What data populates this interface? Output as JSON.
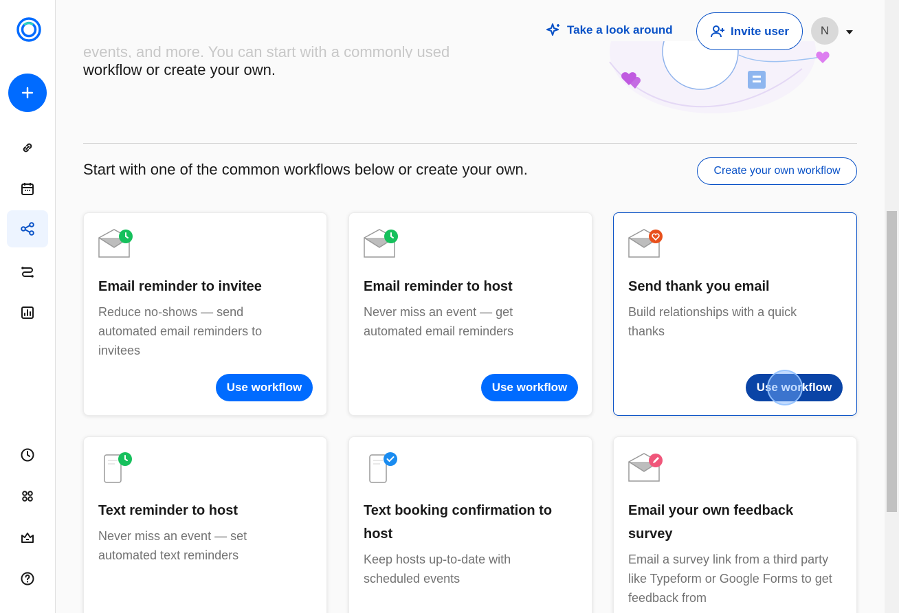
{
  "brand": {
    "accent": "#006bff",
    "accent_dark": "#0a52c7",
    "logo_icon": "calendly-logo"
  },
  "sidebar": {
    "create_icon": "plus-icon",
    "items": [
      {
        "name": "scheduling",
        "icon": "link-icon"
      },
      {
        "name": "meetings",
        "icon": "calendar-icon"
      },
      {
        "name": "workflows",
        "icon": "workflow-icon",
        "active": true
      },
      {
        "name": "routing",
        "icon": "routing-icon"
      },
      {
        "name": "analytics",
        "icon": "analytics-icon"
      }
    ],
    "bottom_items": [
      {
        "name": "availability",
        "icon": "clock-icon"
      },
      {
        "name": "integrations",
        "icon": "apps-icon"
      },
      {
        "name": "admin",
        "icon": "crown-icon"
      },
      {
        "name": "help",
        "icon": "help-icon"
      }
    ]
  },
  "header": {
    "tour_label": "Take a look around",
    "invite_label": "Invite user",
    "avatar_initial": "N"
  },
  "intro": {
    "faded_line": "events, and more. You can start with a commonly used",
    "line": "workflow or create your own."
  },
  "section": {
    "heading": "Start with one of the common workflows below or create your own.",
    "create_label": "Create your own workflow"
  },
  "cards": [
    {
      "title": "Email reminder to invitee",
      "desc": "Reduce no-shows — send automated email reminders to invitees",
      "button": "Use workflow",
      "icon": "email-clock-icon"
    },
    {
      "title": "Email reminder to host",
      "desc": "Never miss an event — get automated email reminders",
      "button": "Use workflow",
      "icon": "email-clock-icon"
    },
    {
      "title": "Send thank you email",
      "desc": "Build relationships with a quick thanks",
      "button": "Use workflow",
      "icon": "email-heart-icon"
    },
    {
      "title": "Text reminder to host",
      "desc": "Never miss an event — set automated text reminders",
      "icon": "phone-clock-icon"
    },
    {
      "title": "Text booking confirmation to host",
      "desc": "Keep hosts up-to-date with scheduled events",
      "icon": "phone-check-icon"
    },
    {
      "title": "Email your own feedback survey",
      "desc": "Email a survey link from a third party like Typeform or Google Forms to get feedback from",
      "icon": "email-pencil-icon"
    }
  ]
}
